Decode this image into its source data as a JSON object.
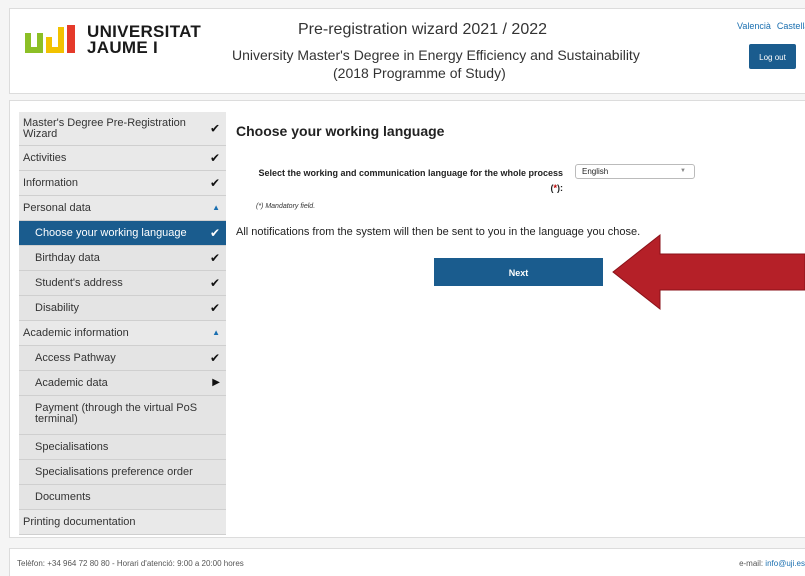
{
  "header": {
    "logo_line1": "UNIVERSITAT",
    "logo_line2": "JAUME I",
    "title": "Pre-registration wizard 2021 / 2022",
    "subtitle_line1": "University Master's Degree in Energy Efficiency and Sustainability",
    "subtitle_line2": "(2018 Programme of Study)",
    "lang_valencia": "Valencià",
    "lang_castellano": "Castellano",
    "logout_label": "Log out"
  },
  "sidebar": {
    "items": [
      {
        "label": "Master's Degree Pre-Registration Wizard",
        "mark": "✔"
      },
      {
        "label": "Activities",
        "mark": "✔"
      },
      {
        "label": "Information",
        "mark": "✔"
      },
      {
        "label": "Personal data",
        "mark": "▲"
      },
      {
        "label": "Choose your working language",
        "mark": "✔"
      },
      {
        "label": "Birthday data",
        "mark": "✔"
      },
      {
        "label": "Student's address",
        "mark": "✔"
      },
      {
        "label": "Disability",
        "mark": "✔"
      },
      {
        "label": "Academic information",
        "mark": "▲"
      },
      {
        "label": "Access Pathway",
        "mark": "✔"
      },
      {
        "label": "Academic data",
        "mark": "▶"
      },
      {
        "label": "Payment (through the virtual PoS terminal)",
        "mark": ""
      },
      {
        "label": "Specialisations",
        "mark": ""
      },
      {
        "label": "Specialisations preference order",
        "mark": ""
      },
      {
        "label": "Documents",
        "mark": ""
      },
      {
        "label": "Printing documentation",
        "mark": ""
      }
    ],
    "active_index": 4
  },
  "content": {
    "title": "Choose your working language",
    "question": "Select the working and communication language for the whole process",
    "required_open": "(",
    "required_star": "*",
    "required_close": "):",
    "language_value": "English",
    "mandatory_note": "(*)  Mandatory field.",
    "notification_text": "All notifications from the system will then be sent to you in the language you chose.",
    "next_label": "Next"
  },
  "footer": {
    "contact": "Telèfon: +34 964 72 80 80 - Horari d'atenció: 9:00 a 20:00 hores",
    "email_label": "e-mail: ",
    "email": "info@uji.es"
  },
  "colors": {
    "primary": "#1a5c8e",
    "arrow": "#b52028",
    "logo_yellow": "#f2c200",
    "logo_red": "#e53a2a",
    "logo_green": "#8cbf26"
  }
}
